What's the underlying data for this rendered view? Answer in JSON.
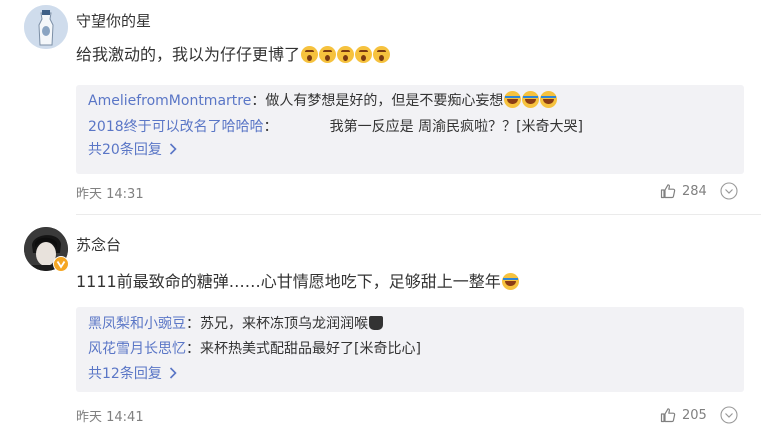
{
  "comments": [
    {
      "username": "守望你的星",
      "text": "给我激动的，我以为仔仔更博了",
      "text_emojis": [
        "shock-emoji",
        "shock-emoji",
        "shock-emoji",
        "shock-emoji",
        "shock-emoji"
      ],
      "replies": [
        {
          "user": "AmeliefromMontmartre",
          "sep": "：",
          "text": "做人有梦想是好的，但是不要痴心妄想",
          "emojis": [
            "laugh-emoji",
            "laugh-emoji",
            "laugh-emoji"
          ]
        },
        {
          "user": "2018终于可以改名了哈哈哈",
          "sep": "：",
          "text": "我第一反应是 周渝民疯啦？？[米奇大哭]",
          "emojis": []
        }
      ],
      "more_replies": "共20条回复",
      "time": "昨天 14:31",
      "likes": "284"
    },
    {
      "username": "苏念台",
      "text": "1111前最致命的糖弹……心甘情愿地吃下，足够甜上一整年",
      "text_emojis": [
        "laugh-emoji"
      ],
      "replies": [
        {
          "user": "黑凤梨和小豌豆",
          "sep": "：",
          "text": "苏兄，来杯冻顶乌龙润润喉",
          "emojis": [
            "cup-emoji"
          ]
        },
        {
          "user": "风花雪月长思忆",
          "sep": "：",
          "text": "来杯热美式配甜品最好了[米奇比心]",
          "emojis": []
        }
      ],
      "more_replies": "共12条回复",
      "time": "昨天 14:41",
      "likes": "205"
    }
  ],
  "colors": {
    "link": "#5a76c6",
    "reply_bg": "#f2f2f5",
    "meta": "#808080",
    "verified_badge": "#f5a623"
  },
  "icons": [
    "thumbs-up-icon",
    "chevron-down-icon",
    "chevron-right-icon",
    "verified-badge-icon"
  ]
}
